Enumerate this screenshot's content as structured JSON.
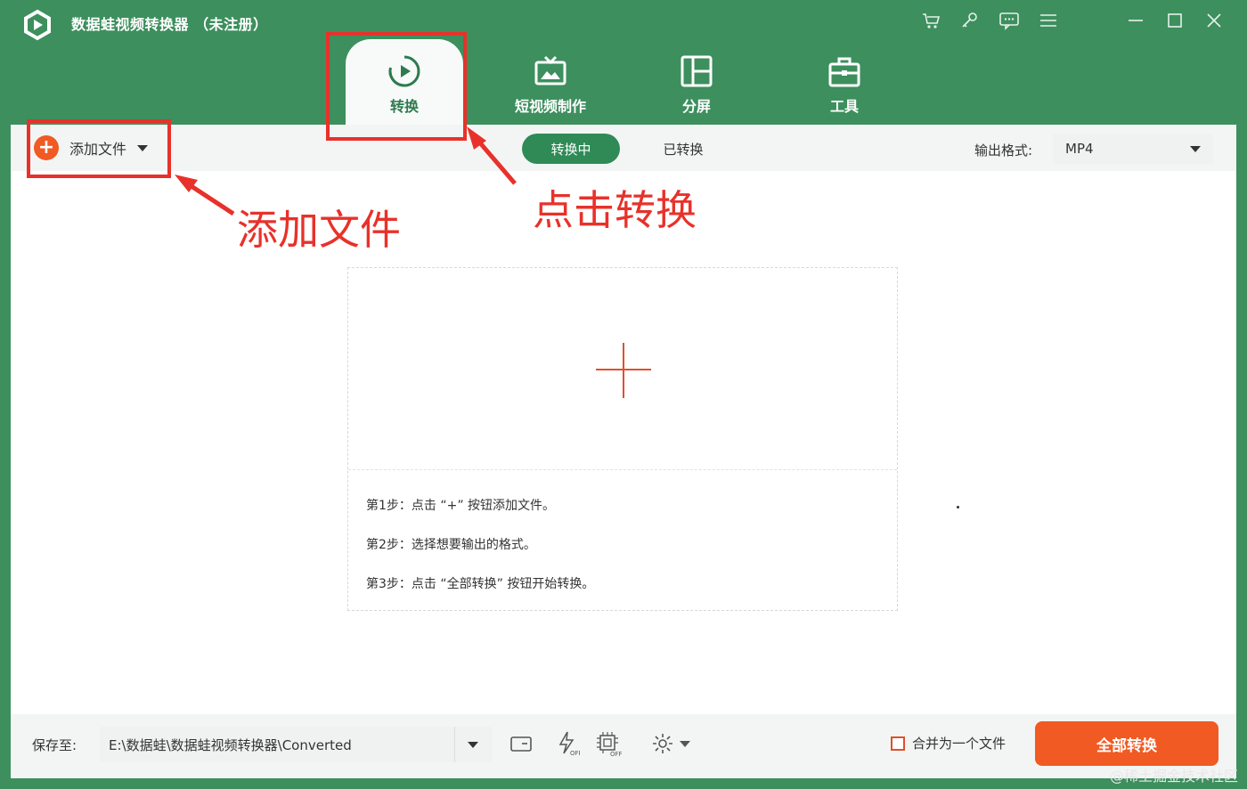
{
  "window": {
    "title": "数据蛙视频转换器 （未注册）",
    "icons": [
      "cart-icon",
      "key-icon",
      "chat-icon",
      "menu-icon",
      "minimize-icon",
      "maximize-icon",
      "close-icon"
    ]
  },
  "nav": {
    "tabs": [
      {
        "label": "转换",
        "icon": "convert-icon",
        "active": true
      },
      {
        "label": "短视频制作",
        "icon": "tv-icon",
        "active": false
      },
      {
        "label": "分屏",
        "icon": "split-screen-icon",
        "active": false
      },
      {
        "label": "工具",
        "icon": "toolbox-icon",
        "active": false
      }
    ]
  },
  "toolbar": {
    "add_file_label": "添加文件",
    "seg_converting": "转换中",
    "seg_converted": "已转换",
    "output_format_label": "输出格式:",
    "output_format_value": "MP4"
  },
  "dropzone": {
    "steps": [
      "第1步：点击 “+” 按钮添加文件。",
      "第2步：选择想要输出的格式。",
      "第3步：点击 “全部转换” 按钮开始转换。"
    ]
  },
  "bottom": {
    "save_label": "保存至:",
    "save_path": "E:\\数据蛙\\数据蛙视频转换器\\Converted",
    "merge_label": "合并为一个文件",
    "convert_all_label": "全部转换"
  },
  "annotations": {
    "add_file": "添加文件",
    "click_convert": "点击转换"
  },
  "watermark": "@稀土掘金技术社区",
  "colors": {
    "brand_green": "#3d8f5e",
    "accent_orange": "#f15a22",
    "annotation_red": "#e8312a"
  }
}
